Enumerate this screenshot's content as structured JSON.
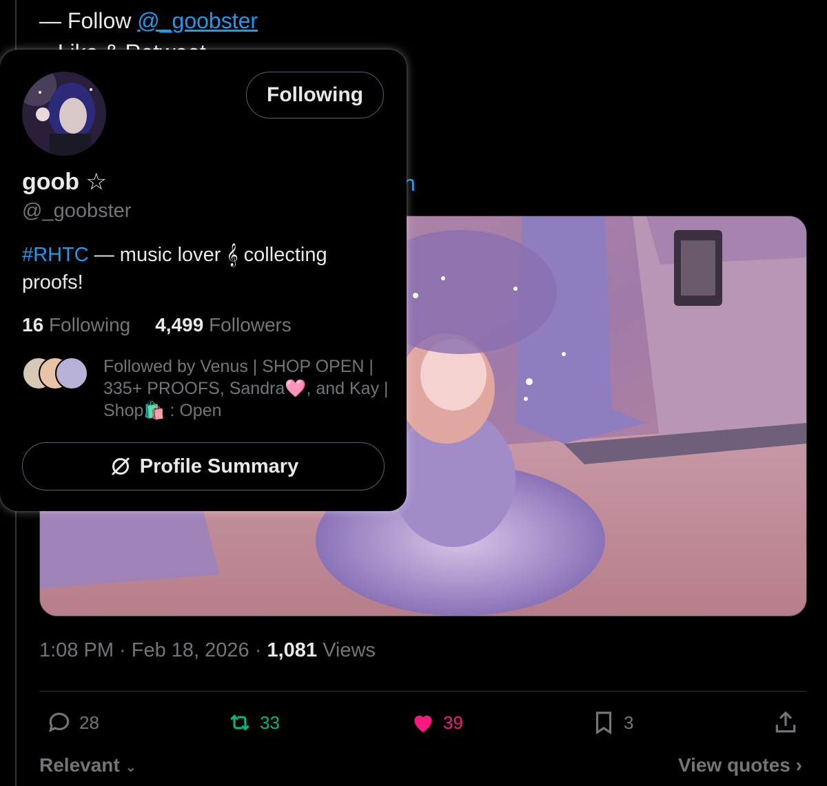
{
  "tweet": {
    "follow_prefix": "— Follow ",
    "follow_mention": "@_goobster",
    "line2_partial": "– Like & Retweet",
    "stray_partial": "h"
  },
  "hover_card": {
    "follow_button": "Following",
    "name": "goob ☆",
    "handle": "@_goobster",
    "bio_hashtag": "#RHTC",
    "bio_text": " — music lover 𝄞 collecting proofs!",
    "following_count": "16",
    "following_label": "Following",
    "followers_count": "4,499",
    "followers_label": "Followers",
    "followed_by": "Followed by Venus | SHOP OPEN | 335+ PROOFS, Sandra🩷, and Kay | Shop🛍️ : Open",
    "summary_button": "Profile Summary"
  },
  "meta": {
    "time": "1:08 PM · Feb 18, 2026 · ",
    "views_count": "1,081",
    "views_label": " Views"
  },
  "actions": {
    "replies": "28",
    "reposts": "33",
    "likes": "39",
    "bookmarks": "3"
  },
  "footer": {
    "sort": "Relevant",
    "view_quotes": "View quotes"
  },
  "colors": {
    "accent": "#1d9bf0",
    "repost": "#00ba7c",
    "like": "#f91880",
    "muted": "#71767b"
  }
}
